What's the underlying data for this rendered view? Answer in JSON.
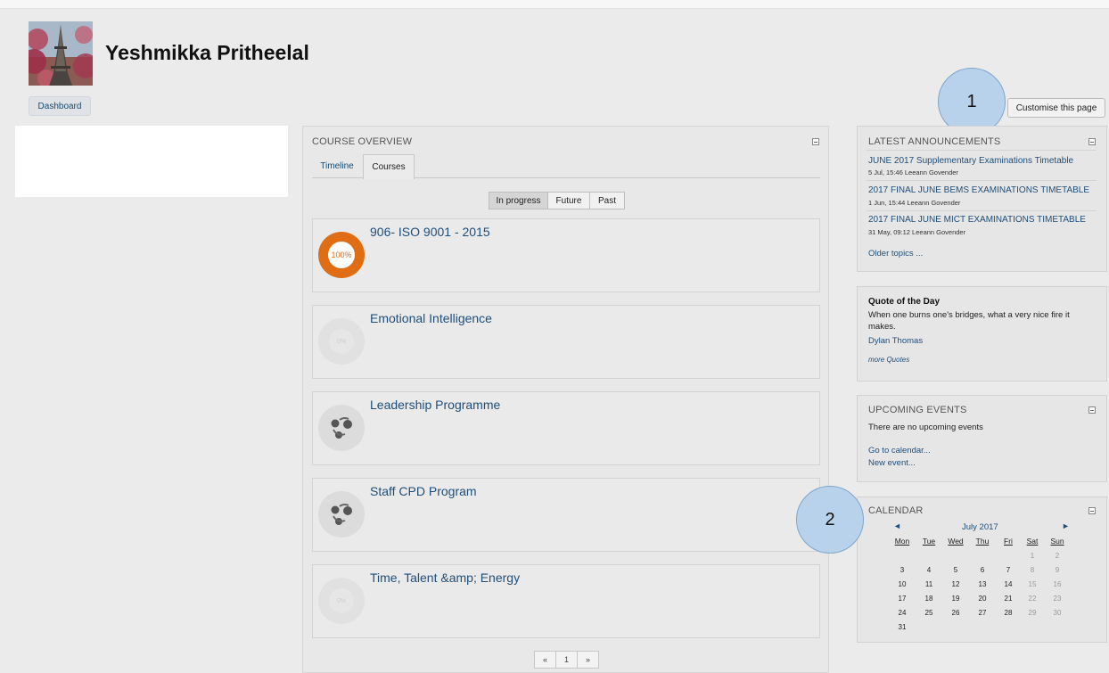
{
  "user": {
    "name": "Yeshmikka Pritheelal"
  },
  "nav": {
    "dashboard_label": "Dashboard",
    "customise_label": "Customise this page"
  },
  "callouts": [
    "1",
    "2"
  ],
  "course_overview": {
    "title": "COURSE OVERVIEW",
    "tabs": [
      "Timeline",
      "Courses"
    ],
    "filters": [
      "In progress",
      "Future",
      "Past"
    ],
    "courses": [
      {
        "title": "906- ISO 9001 - 2015",
        "progress_label": "100%",
        "progress": 1.0,
        "indicator": "progress-ring"
      },
      {
        "title": "Emotional Intelligence",
        "progress_label": "0%",
        "progress": 0.0,
        "indicator": "progress-ring"
      },
      {
        "title": "Leadership Programme",
        "indicator": "course-icon"
      },
      {
        "title": "Staff CPD Program",
        "indicator": "course-icon"
      },
      {
        "title": "Time, Talent &amp; Energy",
        "progress_label": "0%",
        "progress": 0.0,
        "indicator": "progress-ring"
      }
    ],
    "pager": [
      "«",
      "1",
      "»"
    ]
  },
  "announcements": {
    "title": "LATEST ANNOUNCEMENTS",
    "items": [
      {
        "title": "JUNE 2017 Supplementary Examinations Timetable",
        "meta": "5 Jul, 15:46 Leeann Govender"
      },
      {
        "title": "2017 FINAL JUNE BEMS EXAMINATIONS TIMETABLE",
        "meta": "1 Jun, 15:44 Leeann Govender"
      },
      {
        "title": "2017 FINAL JUNE MICT EXAMINATIONS TIMETABLE",
        "meta": "31 May, 09:12 Leeann Govender"
      }
    ],
    "older_label": "Older topics ..."
  },
  "quote": {
    "title": "Quote of the Day",
    "text": "When one burns one's bridges, what a very nice fire it makes.",
    "author": "Dylan Thomas",
    "more_label": "more Quotes"
  },
  "events": {
    "title": "UPCOMING EVENTS",
    "empty_text": "There are no upcoming events",
    "goto_label": "Go to calendar...",
    "new_label": "New event..."
  },
  "calendar": {
    "title": "CALENDAR",
    "month": "July 2017",
    "prev_icon": "◄",
    "next_icon": "►",
    "weekdays": [
      "Mon",
      "Tue",
      "Wed",
      "Thu",
      "Fri",
      "Sat",
      "Sun"
    ],
    "weeks": [
      [
        "",
        "",
        "",
        "",
        "",
        "1",
        "2"
      ],
      [
        "3",
        "4",
        "5",
        "6",
        "7",
        "8",
        "9"
      ],
      [
        "10",
        "11",
        "12",
        "13",
        "14",
        "15",
        "16"
      ],
      [
        "17",
        "18",
        "19",
        "20",
        "21",
        "22",
        "23"
      ],
      [
        "24",
        "25",
        "26",
        "27",
        "28",
        "29",
        "30"
      ],
      [
        "31",
        "",
        "",
        "",
        "",
        "",
        ""
      ]
    ]
  }
}
